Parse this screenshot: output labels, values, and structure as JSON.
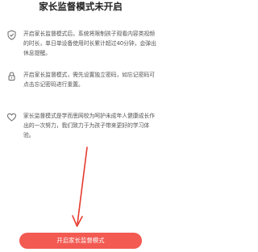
{
  "page": {
    "title": "家长监督模式未开启"
  },
  "features": [
    {
      "icon": "shield-check-icon",
      "text": "开启家长监督模式后，系统将限制孩子观看内容类视频的时长，单日单设备使用时长累计超过40分钟，会弹出休息提醒。"
    },
    {
      "icon": "lock-icon",
      "text": "开启家长监督模式，需先设置独立密码，如忘记密码可点击忘记密码进行重置。"
    },
    {
      "icon": "heart-icon",
      "text": "家长监督模式是学而思网校为呵护未成年人健康成长作出的一次努力，我们致力于为孩子带来更好的学习体验。"
    }
  ],
  "button": {
    "label": "开启家长监督模式",
    "color": "#f25a52"
  },
  "annotation": {
    "arrow_color": "#e63a2e"
  }
}
